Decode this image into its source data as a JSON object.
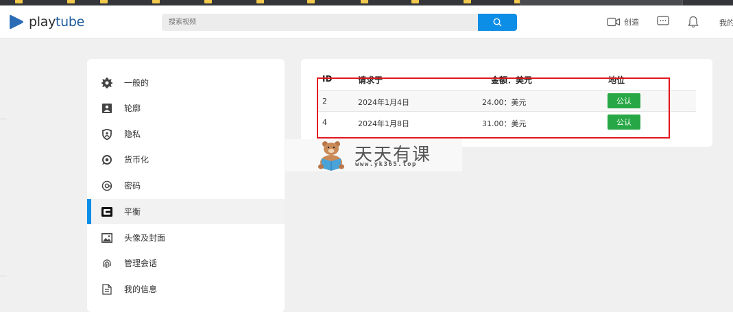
{
  "bookmarks": {
    "items": [
      "",
      "",
      "",
      "",
      "",
      "",
      "",
      "",
      "",
      "",
      "",
      "",
      ""
    ]
  },
  "header": {
    "logo_text_play": "play",
    "logo_text_tube": "tube",
    "search_placeholder": "搜索视频",
    "create_label": "创造",
    "me_label": "我的"
  },
  "sidebar": {
    "items": [
      {
        "label": "一般的",
        "icon": "gear-icon"
      },
      {
        "label": "轮廓",
        "icon": "profile-card-icon"
      },
      {
        "label": "隐私",
        "icon": "shield-icon"
      },
      {
        "label": "货币化",
        "icon": "monetization-icon"
      },
      {
        "label": "密码",
        "icon": "key-icon"
      },
      {
        "label": "平衡",
        "icon": "wallet-icon",
        "active": true
      },
      {
        "label": "头像及封面",
        "icon": "image-icon"
      },
      {
        "label": "管理会话",
        "icon": "fingerprint-icon"
      },
      {
        "label": "我的信息",
        "icon": "document-icon"
      }
    ]
  },
  "table": {
    "headers": {
      "id": "ID",
      "requested": "请求于",
      "amount": "金额：美元",
      "status": "地位"
    },
    "rows": [
      {
        "id": "2",
        "requested": "2024年1月4日",
        "amount": "24.00：美元",
        "status": "公认"
      },
      {
        "id": "4",
        "requested": "2024年1月8日",
        "amount": "31.00：美元",
        "status": "公认"
      }
    ]
  },
  "watermark": {
    "title": "天天有课",
    "url": "www.yk365.top"
  },
  "colors": {
    "accent": "#0d8ee6",
    "status_green": "#27a745",
    "annotation_red": "#e0151d",
    "logo_blue": "#2a6db6"
  }
}
